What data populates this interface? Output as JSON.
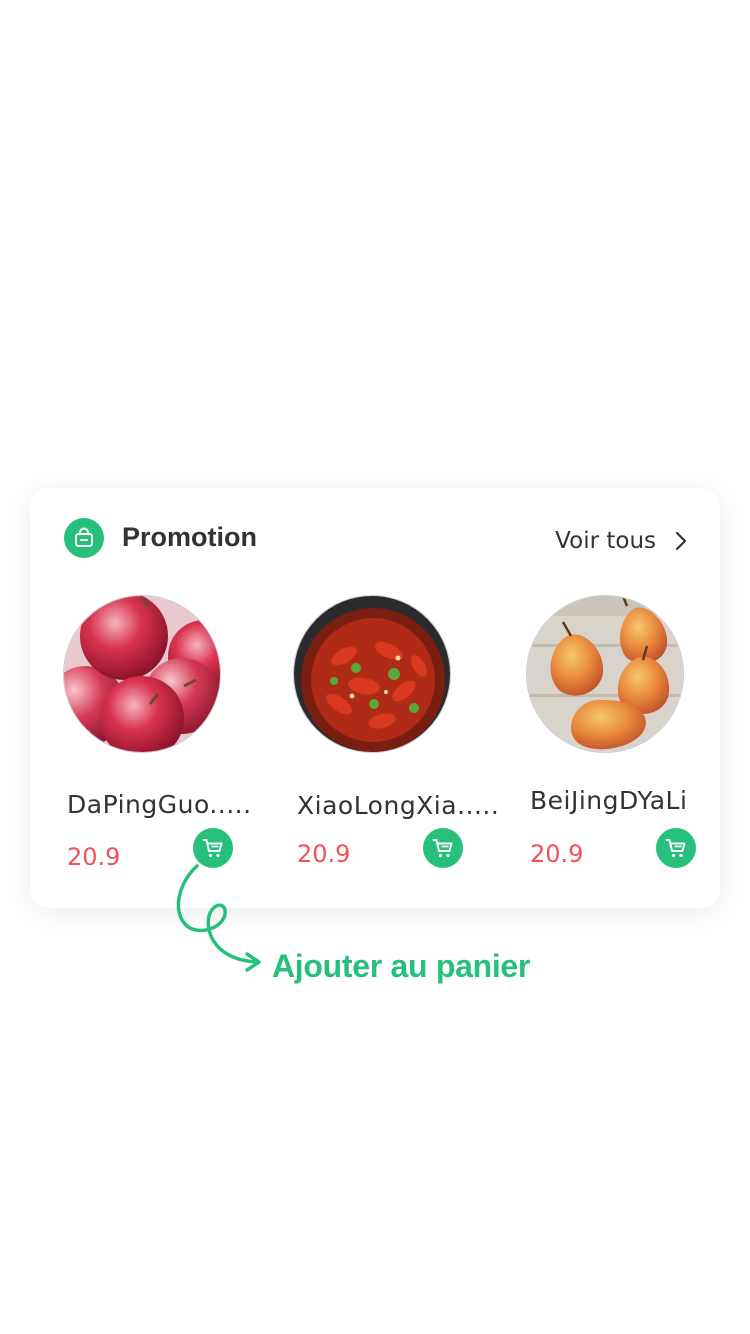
{
  "section": {
    "title": "Promotion",
    "icon": "shopping-bag-icon",
    "see_all_label": "Voir tous",
    "see_all_icon": "chevron-right-icon"
  },
  "products": [
    {
      "name": "DaPingGuo.....",
      "price": "20.9",
      "image": "red-apples",
      "cart_icon": "cart-icon"
    },
    {
      "name": "XiaoLongXia.....",
      "price": "20.9",
      "image": "crayfish-dish",
      "cart_icon": "cart-icon"
    },
    {
      "name": "BeiJingDYaLi",
      "price": "20.9",
      "image": "pears",
      "cart_icon": "cart-icon"
    }
  ],
  "annotation": {
    "text": "Ajouter au panier"
  },
  "colors": {
    "accent": "#27c07a",
    "price": "#f0515a",
    "text": "#333333"
  }
}
